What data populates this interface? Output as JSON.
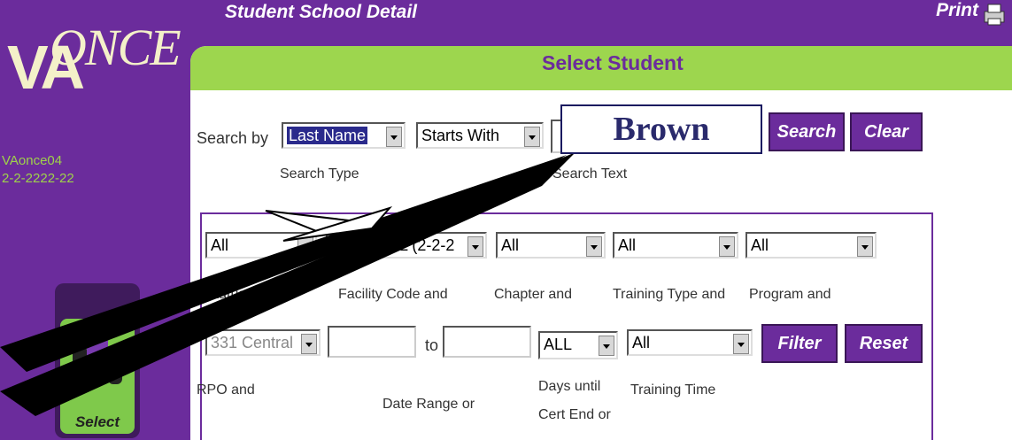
{
  "header": {
    "title": "Student School Detail",
    "print_label": "Print"
  },
  "sidebar": {
    "logo_va": "VA",
    "logo_once": "ONCE",
    "user_id": "VAonce04",
    "user_code": "2-2-2222-22",
    "select_label": "Select"
  },
  "panel": {
    "heading": "Select Student"
  },
  "search": {
    "search_by_label": "Search by",
    "search_type": {
      "value": "Last Name",
      "label": "Search Type"
    },
    "search_condition": {
      "value": "Starts With"
    },
    "search_text": {
      "value": "Brown",
      "label": "Search Text"
    },
    "search_button": "Search",
    "clear_button": "Clear"
  },
  "filters": {
    "row1": [
      {
        "value": "All",
        "label": "Status and"
      },
      {
        "value": "DEMO IHL (2-2-2",
        "label": "Facility Code and"
      },
      {
        "value": "All",
        "label": "Chapter and"
      },
      {
        "value": "All",
        "label": "Training Type and"
      },
      {
        "value": "All",
        "label": "Program and"
      }
    ],
    "rpo": {
      "value": "331 Central",
      "label": "RPO and"
    },
    "date_range": {
      "from": "",
      "to_label": "to",
      "to": "",
      "label": "Date Range or"
    },
    "days_until": {
      "value": "ALL",
      "label_line1": "Days until",
      "label_line2": "Cert End or"
    },
    "training_time": {
      "value": "All",
      "label": "Training Time"
    },
    "filter_button": "Filter",
    "reset_button": "Reset"
  },
  "colors": {
    "purple": "#6b2c9c",
    "green": "#9dd64e",
    "cream": "#f4f1c9",
    "user_text": "#9fd24a"
  }
}
